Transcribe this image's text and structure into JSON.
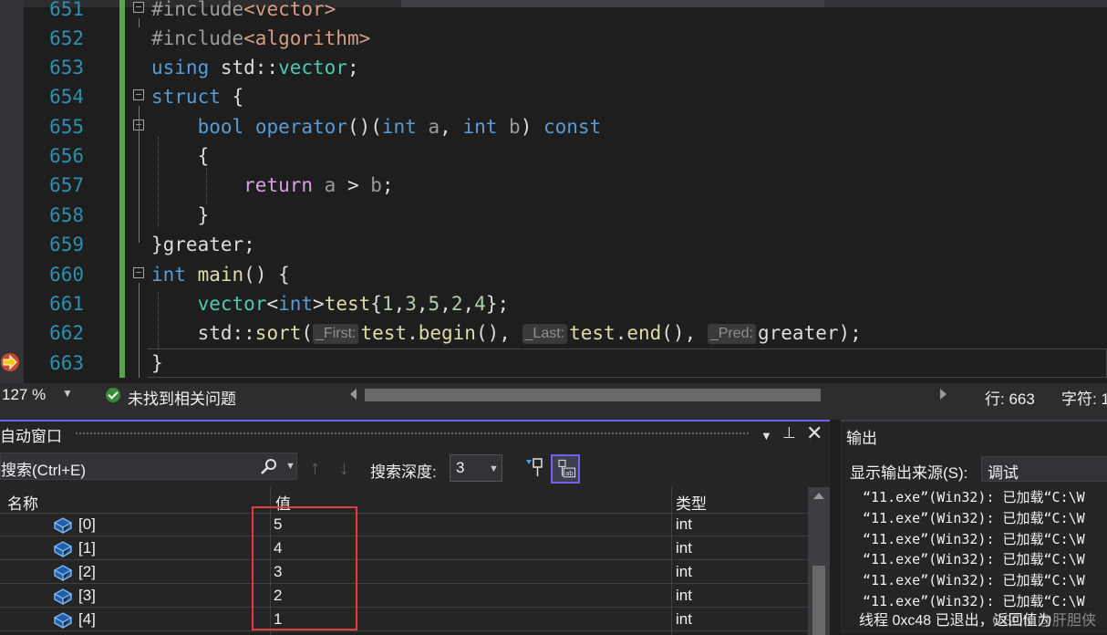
{
  "editor": {
    "lines": [
      {
        "num": "651",
        "text": "#include<vector>"
      },
      {
        "num": "652",
        "text": "#include<algorithm>"
      },
      {
        "num": "653",
        "text": "using std::vector;"
      },
      {
        "num": "654",
        "text": "struct {"
      },
      {
        "num": "655",
        "text": "bool operator()(int a, int b) const"
      },
      {
        "num": "656",
        "text": "{"
      },
      {
        "num": "657",
        "text": "return a > b;"
      },
      {
        "num": "658",
        "text": "}"
      },
      {
        "num": "659",
        "text": "}greater;"
      },
      {
        "num": "660",
        "text": "int main() {"
      },
      {
        "num": "661",
        "text": "vector<int>test{1,3,5,2,4};"
      },
      {
        "num": "662",
        "text": "std::sort(_First:test.begin(), _Last:test.end(), _Pred:greater);"
      },
      {
        "num": "663",
        "text": "}"
      }
    ],
    "hints": {
      "first": "_First:",
      "last": "_Last:",
      "pred": "_Pred:"
    }
  },
  "statusbar": {
    "zoom": "127 %",
    "issues": "未找到相关问题",
    "row": "行: 663",
    "col": "字符: 1"
  },
  "autos": {
    "title": "自动窗口",
    "search_placeholder": "搜索(Ctrl+E)",
    "depth_label": "搜索深度:",
    "depth_value": "3",
    "columns": {
      "name": "名称",
      "value": "值",
      "type": "类型"
    },
    "rows": [
      {
        "name": "[0]",
        "value": "5",
        "type": "int"
      },
      {
        "name": "[1]",
        "value": "4",
        "type": "int"
      },
      {
        "name": "[2]",
        "value": "3",
        "type": "int"
      },
      {
        "name": "[3]",
        "value": "2",
        "type": "int"
      },
      {
        "name": "[4]",
        "value": "1",
        "type": "int"
      }
    ]
  },
  "output": {
    "title": "输出",
    "source_label": "显示输出来源(S):",
    "source_value": "调试",
    "lines": [
      "“11.exe”(Win32): 已加载“C:\\W",
      "“11.exe”(Win32): 已加载“C:\\W",
      "“11.exe”(Win32): 已加载“C:\\W",
      "“11.exe”(Win32): 已加载“C:\\W",
      "“11.exe”(Win32): 已加载“C:\\W",
      "“11.exe”(Win32): 已加载“C:\\W"
    ],
    "last_line": "线程 0xc48 已退出，返回值为",
    "watermark": "CSDN @肝胆侠"
  },
  "colors": {
    "accent": "#7160e8",
    "highlight": "#e03c3c",
    "line_number": "#2b91af",
    "change_bar": "#57a64a"
  }
}
